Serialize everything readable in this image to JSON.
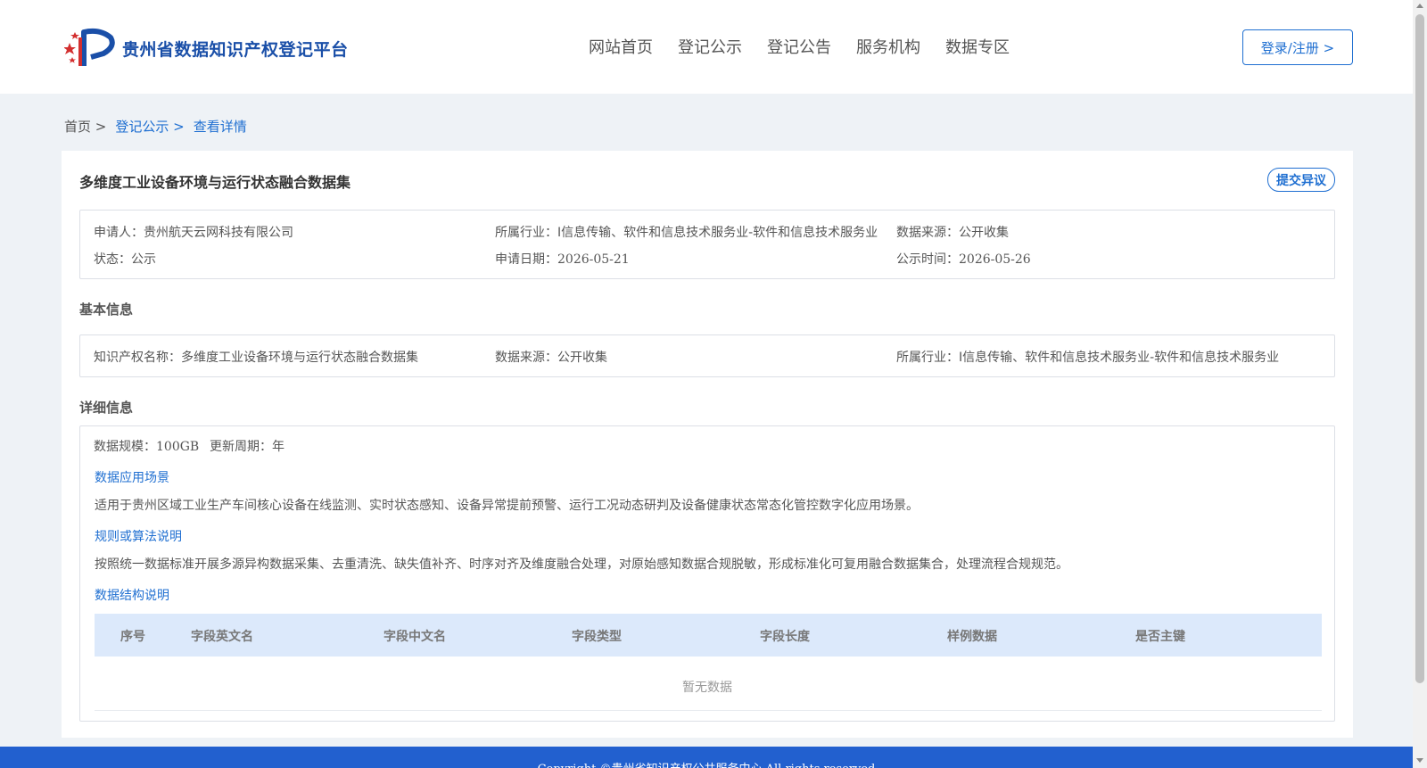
{
  "header": {
    "logo_text": "贵州省数据知识产权登记平台",
    "nav": [
      "网站首页",
      "登记公示",
      "登记公告",
      "服务机构",
      "数据专区"
    ],
    "login_label": "登录/注册 >"
  },
  "breadcrumb": {
    "home": "首页 >",
    "parent": "登记公示 >",
    "current": "查看详情"
  },
  "detail": {
    "title": "多维度工业设备环境与运行状态融合数据集",
    "objection_label": "提交异议",
    "summary": {
      "applicant_label": "申请人：",
      "applicant": "贵州航天云网科技有限公司",
      "industry_label": "所属行业：",
      "industry": "I信息传输、软件和信息技术服务业-软件和信息技术服务业",
      "source_label": "数据来源：",
      "source": "公开收集",
      "status_label": "状态：",
      "status": "公示",
      "apply_date_label": "申请日期：",
      "apply_date": "2026-05-21",
      "publicity_label": "公示时间：",
      "publicity_date": "2026-05-26"
    },
    "basic": {
      "section_title": "基本信息",
      "ip_name_label": "知识产权名称：",
      "ip_name": "多维度工业设备环境与运行状态融合数据集",
      "source_label": "数据来源：",
      "source": "公开收集",
      "industry_label": "所属行业：",
      "industry": "I信息传输、软件和信息技术服务业-软件和信息技术服务业"
    },
    "detailed": {
      "section_title": "详细信息",
      "scale_label": "数据规模：",
      "scale": "100GB",
      "cycle_label": "更新周期：",
      "cycle": "年",
      "scenario_title": "数据应用场景",
      "scenario_text": "适用于贵州区域工业生产车间核心设备在线监测、实时状态感知、设备异常提前预警、运行工况动态研判及设备健康状态常态化管控数字化应用场景。",
      "algorithm_title": "规则或算法说明",
      "algorithm_text": "按照统一数据标准开展多源异构数据采集、去重清洗、缺失值补齐、时序对齐及维度融合处理，对原始感知数据合规脱敏，形成标准化可复用融合数据集合，处理流程合规规范。",
      "structure_title": "数据结构说明",
      "table_headers": [
        "序号",
        "字段英文名",
        "字段中文名",
        "字段类型",
        "字段长度",
        "样例数据",
        "是否主键"
      ],
      "empty_text": "暂无数据"
    }
  },
  "footer": {
    "copyright": "Copyright ©贵州省知识产权公共服务中心 All rights reserved"
  },
  "colors": {
    "primary": "#1f6fd1",
    "footer_bg": "#2260cf",
    "table_head_bg": "#dce9fb",
    "page_bg": "#eef2f6"
  }
}
